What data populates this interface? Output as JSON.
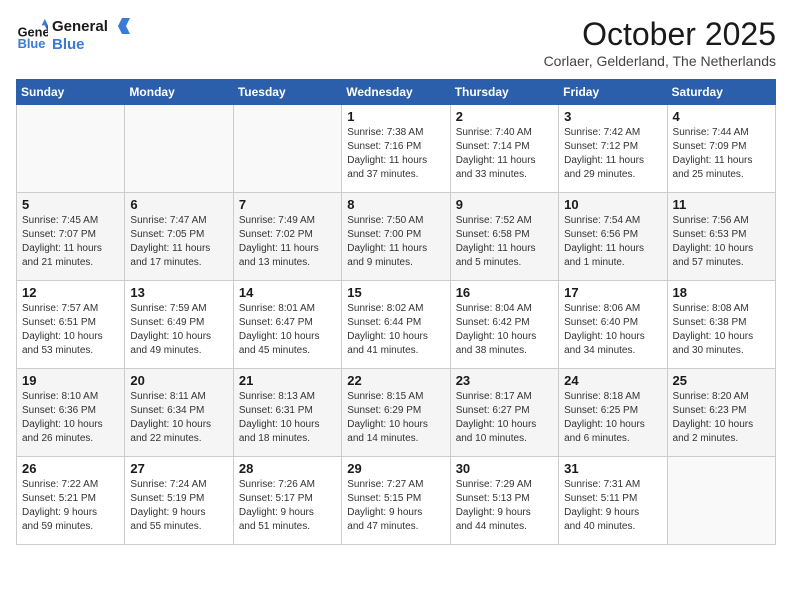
{
  "logo": {
    "line1": "General",
    "line2": "Blue"
  },
  "title": "October 2025",
  "location": "Corlaer, Gelderland, The Netherlands",
  "weekdays": [
    "Sunday",
    "Monday",
    "Tuesday",
    "Wednesday",
    "Thursday",
    "Friday",
    "Saturday"
  ],
  "weeks": [
    [
      {
        "day": "",
        "info": ""
      },
      {
        "day": "",
        "info": ""
      },
      {
        "day": "",
        "info": ""
      },
      {
        "day": "1",
        "info": "Sunrise: 7:38 AM\nSunset: 7:16 PM\nDaylight: 11 hours\nand 37 minutes."
      },
      {
        "day": "2",
        "info": "Sunrise: 7:40 AM\nSunset: 7:14 PM\nDaylight: 11 hours\nand 33 minutes."
      },
      {
        "day": "3",
        "info": "Sunrise: 7:42 AM\nSunset: 7:12 PM\nDaylight: 11 hours\nand 29 minutes."
      },
      {
        "day": "4",
        "info": "Sunrise: 7:44 AM\nSunset: 7:09 PM\nDaylight: 11 hours\nand 25 minutes."
      }
    ],
    [
      {
        "day": "5",
        "info": "Sunrise: 7:45 AM\nSunset: 7:07 PM\nDaylight: 11 hours\nand 21 minutes."
      },
      {
        "day": "6",
        "info": "Sunrise: 7:47 AM\nSunset: 7:05 PM\nDaylight: 11 hours\nand 17 minutes."
      },
      {
        "day": "7",
        "info": "Sunrise: 7:49 AM\nSunset: 7:02 PM\nDaylight: 11 hours\nand 13 minutes."
      },
      {
        "day": "8",
        "info": "Sunrise: 7:50 AM\nSunset: 7:00 PM\nDaylight: 11 hours\nand 9 minutes."
      },
      {
        "day": "9",
        "info": "Sunrise: 7:52 AM\nSunset: 6:58 PM\nDaylight: 11 hours\nand 5 minutes."
      },
      {
        "day": "10",
        "info": "Sunrise: 7:54 AM\nSunset: 6:56 PM\nDaylight: 11 hours\nand 1 minute."
      },
      {
        "day": "11",
        "info": "Sunrise: 7:56 AM\nSunset: 6:53 PM\nDaylight: 10 hours\nand 57 minutes."
      }
    ],
    [
      {
        "day": "12",
        "info": "Sunrise: 7:57 AM\nSunset: 6:51 PM\nDaylight: 10 hours\nand 53 minutes."
      },
      {
        "day": "13",
        "info": "Sunrise: 7:59 AM\nSunset: 6:49 PM\nDaylight: 10 hours\nand 49 minutes."
      },
      {
        "day": "14",
        "info": "Sunrise: 8:01 AM\nSunset: 6:47 PM\nDaylight: 10 hours\nand 45 minutes."
      },
      {
        "day": "15",
        "info": "Sunrise: 8:02 AM\nSunset: 6:44 PM\nDaylight: 10 hours\nand 41 minutes."
      },
      {
        "day": "16",
        "info": "Sunrise: 8:04 AM\nSunset: 6:42 PM\nDaylight: 10 hours\nand 38 minutes."
      },
      {
        "day": "17",
        "info": "Sunrise: 8:06 AM\nSunset: 6:40 PM\nDaylight: 10 hours\nand 34 minutes."
      },
      {
        "day": "18",
        "info": "Sunrise: 8:08 AM\nSunset: 6:38 PM\nDaylight: 10 hours\nand 30 minutes."
      }
    ],
    [
      {
        "day": "19",
        "info": "Sunrise: 8:10 AM\nSunset: 6:36 PM\nDaylight: 10 hours\nand 26 minutes."
      },
      {
        "day": "20",
        "info": "Sunrise: 8:11 AM\nSunset: 6:34 PM\nDaylight: 10 hours\nand 22 minutes."
      },
      {
        "day": "21",
        "info": "Sunrise: 8:13 AM\nSunset: 6:31 PM\nDaylight: 10 hours\nand 18 minutes."
      },
      {
        "day": "22",
        "info": "Sunrise: 8:15 AM\nSunset: 6:29 PM\nDaylight: 10 hours\nand 14 minutes."
      },
      {
        "day": "23",
        "info": "Sunrise: 8:17 AM\nSunset: 6:27 PM\nDaylight: 10 hours\nand 10 minutes."
      },
      {
        "day": "24",
        "info": "Sunrise: 8:18 AM\nSunset: 6:25 PM\nDaylight: 10 hours\nand 6 minutes."
      },
      {
        "day": "25",
        "info": "Sunrise: 8:20 AM\nSunset: 6:23 PM\nDaylight: 10 hours\nand 2 minutes."
      }
    ],
    [
      {
        "day": "26",
        "info": "Sunrise: 7:22 AM\nSunset: 5:21 PM\nDaylight: 9 hours\nand 59 minutes."
      },
      {
        "day": "27",
        "info": "Sunrise: 7:24 AM\nSunset: 5:19 PM\nDaylight: 9 hours\nand 55 minutes."
      },
      {
        "day": "28",
        "info": "Sunrise: 7:26 AM\nSunset: 5:17 PM\nDaylight: 9 hours\nand 51 minutes."
      },
      {
        "day": "29",
        "info": "Sunrise: 7:27 AM\nSunset: 5:15 PM\nDaylight: 9 hours\nand 47 minutes."
      },
      {
        "day": "30",
        "info": "Sunrise: 7:29 AM\nSunset: 5:13 PM\nDaylight: 9 hours\nand 44 minutes."
      },
      {
        "day": "31",
        "info": "Sunrise: 7:31 AM\nSunset: 5:11 PM\nDaylight: 9 hours\nand 40 minutes."
      },
      {
        "day": "",
        "info": ""
      }
    ]
  ]
}
